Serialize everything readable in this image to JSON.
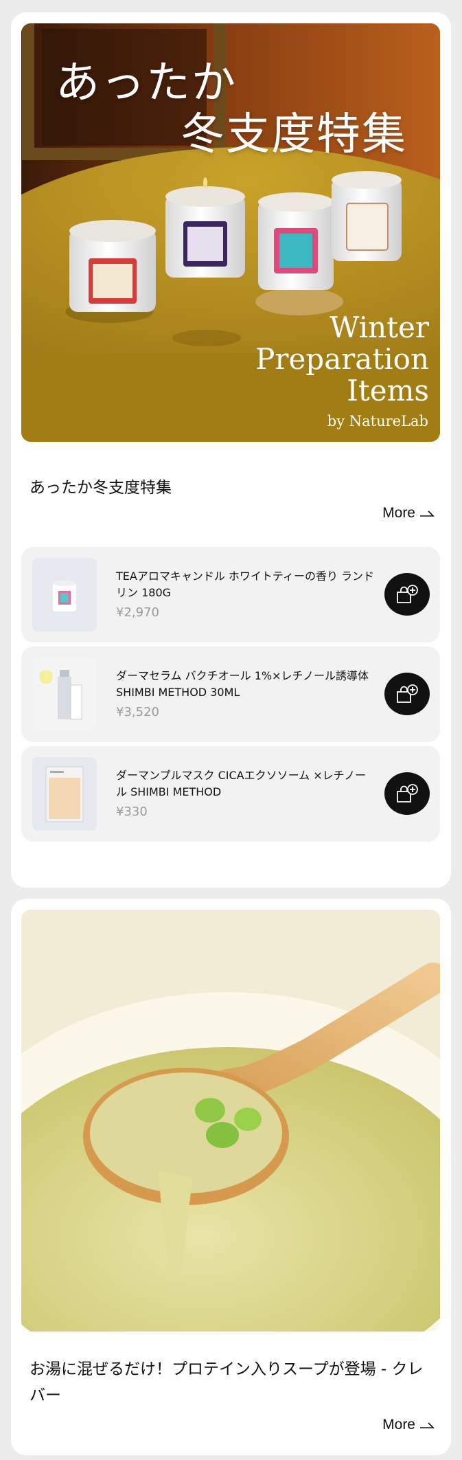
{
  "feature1": {
    "hero": {
      "jp_line1": "あったか",
      "jp_line2": "冬支度特集",
      "en_line1": "Winter",
      "en_line2": "Preparation",
      "en_line3": "Items",
      "by_line": "by NatureLab"
    },
    "title": "あったか冬支度特集",
    "more_label": "More",
    "products": [
      {
        "name": "TEAアロマキャンドル ホワイトティーの香り ランドリン 180G",
        "price": "¥2,970",
        "cart_icon": "bag-plus-icon"
      },
      {
        "name": "ダーマセラム バクチオール 1%×レチノール誘導体 SHIMBI METHOD 30ML",
        "price": "¥3,520",
        "cart_icon": "bag-plus-icon"
      },
      {
        "name": "ダーマンプルマスク CICAエクソソーム ×レチノール SHIMBI METHOD",
        "price": "¥330",
        "cart_icon": "bag-plus-icon"
      }
    ]
  },
  "feature2": {
    "title": "お湯に混ぜるだけ！プロテイン入りスープが登場 - クレバー",
    "more_label": "More"
  },
  "colors": {
    "page_bg": "#ececec",
    "card_bg": "#ffffff",
    "row_bg": "#f2f2f2",
    "cart_button": "#111111",
    "price": "#9a9a9a"
  }
}
